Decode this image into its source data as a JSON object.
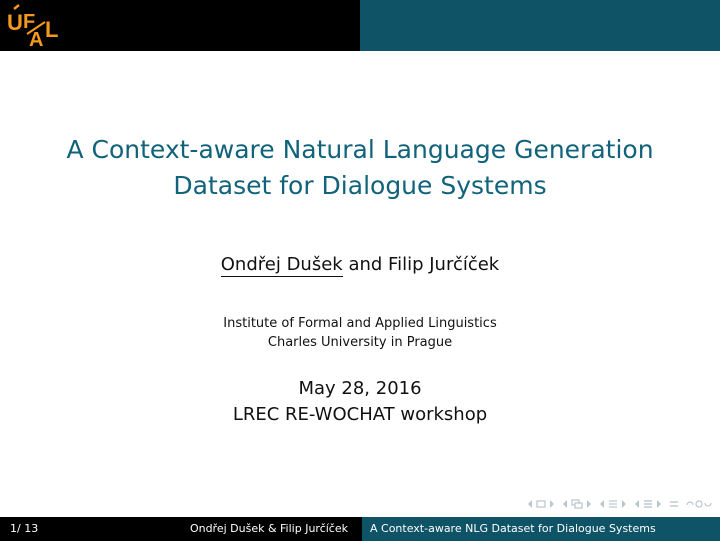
{
  "logo": {
    "text": "ÚFAL",
    "icon": "ufal-logo"
  },
  "title": {
    "line1": "A Context-aware Natural Language Generation",
    "line2": "Dataset for Dialogue Systems"
  },
  "authors": {
    "presenter": "Ondřej Dušek",
    "rest": " and Filip Jurčíček"
  },
  "institute": {
    "line1": "Institute of Formal and Applied Linguistics",
    "line2": "Charles University in Prague"
  },
  "event": {
    "date": "May 28, 2016",
    "workshop": "LREC RE-WOCHAT workshop"
  },
  "footer": {
    "page": "1/ 13",
    "authors": "Ondřej Dušek & Filip Jurčíček",
    "short_title": "A Context-aware NLG Dataset for Dialogue Systems"
  },
  "colors": {
    "header_dark": "#000000",
    "header_teal": "#0f5367",
    "title_teal": "#10637a",
    "logo_orange": "#f39a1e",
    "nav_gray": "#b9c6cc"
  },
  "nav_icons": [
    "nav-left-arrow-icon",
    "frame-icon",
    "nav-right-arrow-icon",
    "subsection-icon",
    "section-icon",
    "document-icon",
    "toc-icon",
    "search-icon"
  ]
}
